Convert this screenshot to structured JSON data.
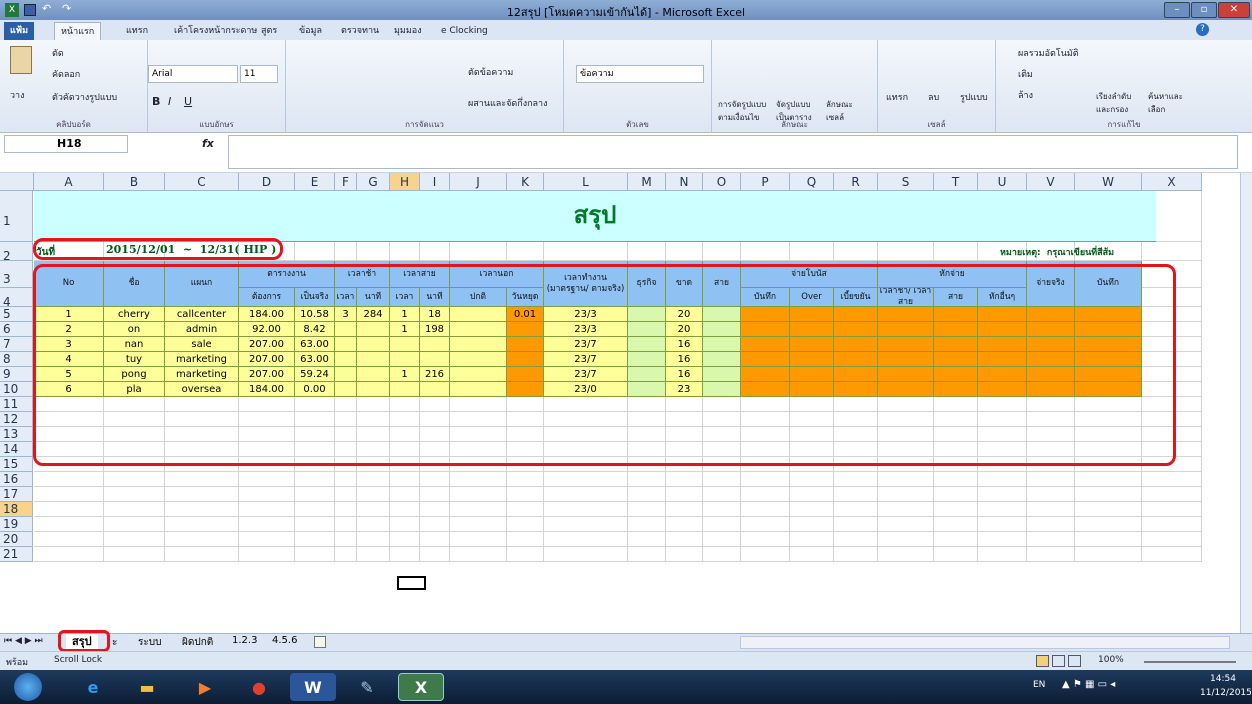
{
  "window": {
    "title": "12สรุป  [โหมดความเข้ากันได้]  -  Microsoft Excel"
  },
  "tabs": [
    "แฟ้ม",
    "หน้าแรก",
    "แทรก",
    "เค้าโครงหน้ากระดาษ",
    "สูตร",
    "ข้อมูล",
    "ตรวจทาน",
    "มุมมอง",
    "e Clocking"
  ],
  "ribbon": {
    "clipboard": {
      "label": "คลิปบอร์ด",
      "paste": "วาง",
      "cut": "ตัด",
      "copy": "คัดลอก",
      "format_painter": "ตัวคัดวางรูปแบบ"
    },
    "font": {
      "label": "แบบอักษร",
      "name": "Arial",
      "size": "11"
    },
    "alignment": {
      "label": "การจัดแนว",
      "wrap": "ตัดข้อความ",
      "merge": "ผสานและจัดกึ่งกลาง"
    },
    "number": {
      "label": "ตัวเลข",
      "format": "ข้อความ"
    },
    "styles": {
      "label": "ลักษณะ",
      "conditional": "การจัดรูปแบบ ตามเงื่อนไข",
      "table": "จัดรูปแบบ เป็นตาราง",
      "cell": "ลักษณะ เซลล์"
    },
    "cells": {
      "label": "เซลล์",
      "insert": "แทรก",
      "delete": "ลบ",
      "format": "รูปแบบ"
    },
    "editing": {
      "label": "การแก้ไข",
      "autosum": "ผลรวมอัตโนมัติ",
      "fill": "เติม",
      "clear": "ล้าง",
      "sort": "เรียงลำดับ และกรอง",
      "find": "ค้นหาและ เลือก"
    }
  },
  "formula_bar": {
    "name_box": "H18",
    "fx": "fx",
    "content": ""
  },
  "columns": [
    "A",
    "B",
    "C",
    "D",
    "E",
    "F",
    "G",
    "H",
    "I",
    "J",
    "K",
    "L",
    "M",
    "N",
    "O",
    "P",
    "Q",
    "R",
    "S",
    "T",
    "U",
    "V",
    "W",
    "X"
  ],
  "rows": [
    "1",
    "2",
    "3",
    "4",
    "5",
    "6",
    "7",
    "8",
    "9",
    "10",
    "11",
    "12",
    "13",
    "14",
    "15",
    "16",
    "17",
    "18",
    "19",
    "20",
    "21"
  ],
  "sheet": {
    "title": "สรุป",
    "date_label": "วันที่",
    "date_value": "2015/12/01  ~  12/31( HIP )",
    "note": "หมายเหตุ:  กรุณาเขียนที่สีส้ม",
    "headers": {
      "no": "No",
      "name": "ชื่อ",
      "dept": "แผนก",
      "schedule": "ตารางงาน",
      "required": "ต้องการ",
      "actual": "เป็นจริง",
      "late": "เวลาช้า",
      "late_time": "เวลา",
      "late_min": "นาที",
      "early": "เวลาสาย",
      "early_time": "เวลา",
      "early_min": "นาที",
      "leave": "เวลานอก",
      "normal": "ปกติ",
      "holiday": "วันหยุด",
      "worktime": "เวลาทำงาน (มาตรฐาน/ ตามจริง)",
      "business": "ธุรกิจ",
      "absent": "ขาด",
      "late2": "สาย",
      "bonus": "จ่ายโบนัส",
      "bonus_rec": "บันทึก",
      "bonus_over": "Over",
      "bonus_allow": "เบี้ยขยัน",
      "deduct": "หักจ่าย",
      "deduct_late": "เวลาช้า/ เวลาสาย",
      "deduct_abs": "สาย",
      "deduct_other": "หักอื่นๆ",
      "paid": "จ่ายจริง",
      "memo": "บันทึก"
    },
    "data": [
      {
        "no": "1",
        "name": "cherry",
        "dept": "callcenter",
        "req": "184.00",
        "act": "10.58",
        "lt": "3",
        "lm": "284",
        "et": "1",
        "em": "18",
        "n": "",
        "h": "0.01",
        "wt": "23/3",
        "ab": "20"
      },
      {
        "no": "2",
        "name": "on",
        "dept": "admin",
        "req": "92.00",
        "act": "8.42",
        "lt": "",
        "lm": "",
        "et": "1",
        "em": "198",
        "n": "",
        "h": "",
        "wt": "23/3",
        "ab": "20"
      },
      {
        "no": "3",
        "name": "nan",
        "dept": "sale",
        "req": "207.00",
        "act": "63.00",
        "lt": "",
        "lm": "",
        "et": "",
        "em": "",
        "n": "",
        "h": "",
        "wt": "23/7",
        "ab": "16"
      },
      {
        "no": "4",
        "name": "tuy",
        "dept": "marketing",
        "req": "207.00",
        "act": "63.00",
        "lt": "",
        "lm": "",
        "et": "",
        "em": "",
        "n": "",
        "h": "",
        "wt": "23/7",
        "ab": "16"
      },
      {
        "no": "5",
        "name": "pong",
        "dept": "marketing",
        "req": "207.00",
        "act": "59.24",
        "lt": "",
        "lm": "",
        "et": "1",
        "em": "216",
        "n": "",
        "h": "",
        "wt": "23/7",
        "ab": "16"
      },
      {
        "no": "6",
        "name": "pla",
        "dept": "oversea",
        "req": "184.00",
        "act": "0.00",
        "lt": "",
        "lm": "",
        "et": "",
        "em": "",
        "n": "",
        "h": "",
        "wt": "23/0",
        "ab": "23"
      }
    ]
  },
  "sheet_tabs": [
    "สรุป",
    "ะ",
    "ระบบ",
    "ผิดปกติ",
    "1.2.3",
    "4.5.6"
  ],
  "status": {
    "ready": "พร้อม",
    "scroll": "Scroll Lock",
    "zoom": "100%"
  },
  "taskbar": {
    "lang": "EN",
    "time": "14:54",
    "date": "11/12/2015"
  },
  "colors": {
    "header": "#8fc2f2",
    "yellow": "#ffff99",
    "green": "#d9f7ad",
    "orange": "#ff9900",
    "title_bg": "#ccffff",
    "highlight": "#e2141c"
  }
}
